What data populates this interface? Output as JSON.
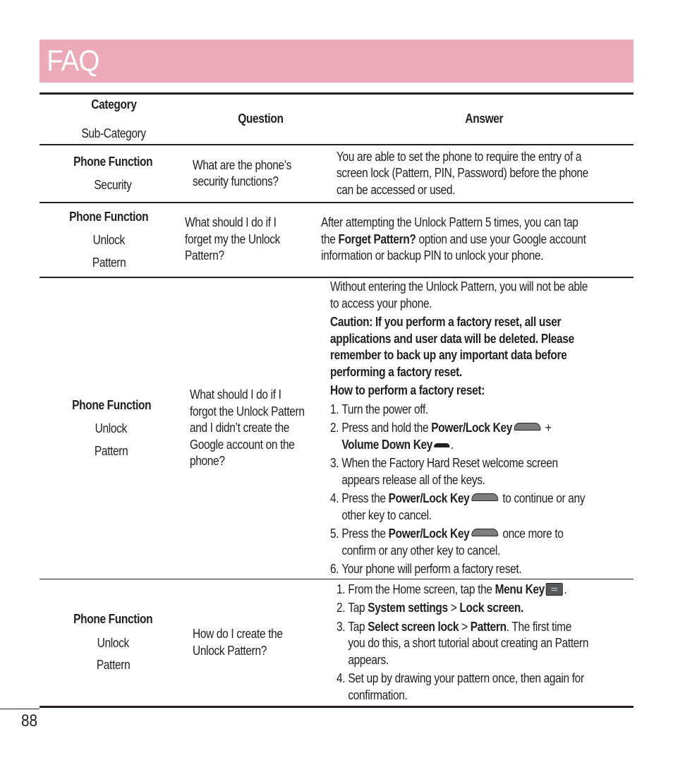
{
  "page": {
    "title": "FAQ",
    "page_number": "88",
    "accent_color": "#eca9b7"
  },
  "table": {
    "headers": {
      "category": "Category",
      "sub_category": "Sub-Category",
      "question": "Question",
      "answer": "Answer"
    },
    "rows": [
      {
        "category": "Phone Function",
        "sub_category": [
          "Security"
        ],
        "question": [
          "What are the phone’s",
          "security functions?"
        ],
        "answer_lines": [
          "You are able to set the phone to require the entry of a",
          "screen lock (Pattern, PIN, Password) before the phone",
          "can be accessed or used."
        ]
      },
      {
        "category": "Phone Function",
        "sub_category": [
          "Unlock",
          "Pattern"
        ],
        "question": [
          "What should I do if I",
          "forget my the Unlock",
          "Pattern?"
        ],
        "answer": {
          "line1": "After attempting the Unlock Pattern 5 times, you can tap",
          "line2_pre": "the ",
          "line2_bold": "Forget Pattern?",
          "line2_post": " option and use your Google account",
          "line3": "information or backup PIN to unlock your phone."
        }
      },
      {
        "category": "Phone Function",
        "sub_category": [
          "Unlock",
          "Pattern"
        ],
        "question": [
          "What should I do if I",
          "forgot the Unlock Pattern",
          "and I didn’t create the",
          "Google account on the",
          "phone?"
        ],
        "answer": {
          "intro": [
            "Without entering the Unlock Pattern, you will not be able",
            "to access your phone."
          ],
          "caution": [
            "Caution: If you perform a factory reset, all user",
            "applications and user data will be deleted. Please",
            "remember to back up any important data before",
            "performing a factory reset."
          ],
          "howto_heading": "How to perform a factory reset:",
          "steps": {
            "s1": {
              "num": "1.",
              "text": "Turn the power off."
            },
            "s2": {
              "num": "2.",
              "pre": "Press and hold the ",
              "bold1": "Power/Lock Key",
              "plus": " +",
              "bold2": "Volume Down Key",
              "post": "."
            },
            "s3": {
              "num": "3.",
              "lines": [
                "When the Factory Hard Reset welcome screen",
                "appears release all of the keys."
              ]
            },
            "s4": {
              "num": "4.",
              "pre": "Press the ",
              "bold": "Power/Lock Key",
              "post": " to continue or any",
              "line2": "other key to cancel."
            },
            "s5": {
              "num": "5.",
              "pre": "Press the ",
              "bold": "Power/Lock Key",
              "post": " once more to",
              "line2": "confirm or any other key to cancel."
            },
            "s6": {
              "num": "6.",
              "text": "Your phone will perform a factory reset."
            }
          }
        }
      },
      {
        "category": "Phone Function",
        "sub_category": [
          "Unlock",
          "Pattern"
        ],
        "question": [
          "How do I create the",
          "Unlock Pattern?"
        ],
        "answer": {
          "s1": {
            "num": "1.",
            "pre": "From the Home screen, tap the ",
            "bold": "Menu Key",
            "post": "."
          },
          "s2": {
            "num": "2.",
            "pre": "Tap ",
            "bold1": "System settings",
            "mid": " > ",
            "bold2": "Lock screen."
          },
          "s3": {
            "num": "3.",
            "pre": "Tap ",
            "bold1": "Select screen lock",
            "mid": " > ",
            "bold2": "Pattern",
            "post": ". The first time",
            "line2": "you do this, a short tutorial about creating an Pattern",
            "line3": "appears."
          },
          "s4": {
            "num": "4.",
            "line1": "Set up by drawing your pattern once, then again for",
            "line2": "confirmation."
          }
        }
      }
    ]
  },
  "icons": {
    "power_lock_key": "power-lock-key-icon",
    "volume_down_key": "volume-down-key-icon",
    "menu_key": "menu-key-icon"
  }
}
